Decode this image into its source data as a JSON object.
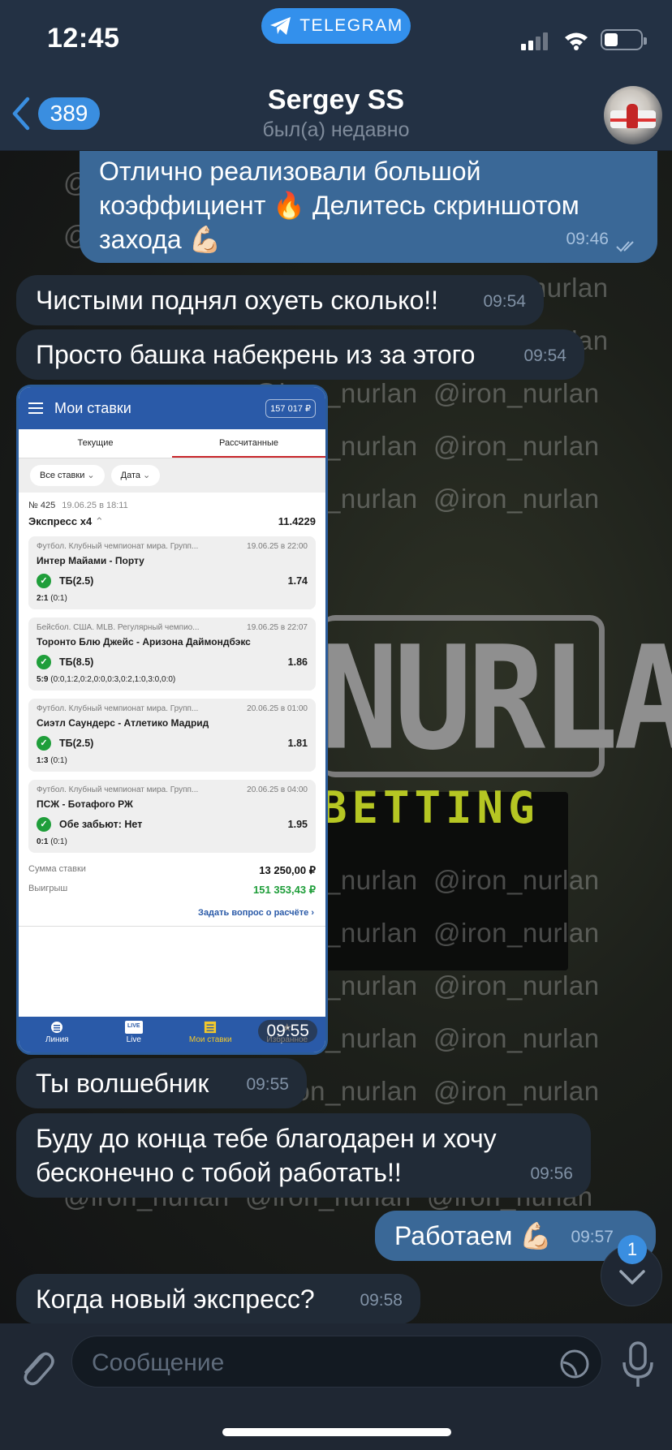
{
  "status_bar": {
    "time": "12:45",
    "app_pill": "TELEGRAM"
  },
  "header": {
    "back_count": "389",
    "name": "Sergey SS",
    "status": "был(а) недавно"
  },
  "watermark": "@iron_nurlan",
  "background_logo": {
    "big": "NURLAN",
    "small": "BETTING"
  },
  "messages": [
    {
      "dir": "out",
      "text": "Отлично реализовали большой коэффициент 🔥 Делитесь скриншотом захода 💪🏻",
      "time": "09:46"
    },
    {
      "dir": "in",
      "text": "Чистыми поднял охуеть сколько!!",
      "time": "09:54"
    },
    {
      "dir": "in",
      "text": "Просто башка набекрень из за этого",
      "time": "09:54"
    },
    {
      "dir": "in",
      "text": "Ты волшебник",
      "time": "09:55"
    },
    {
      "dir": "in",
      "text": "Буду до конца тебе благодарен и хочу бесконечно с тобой работать!!",
      "time": "09:56"
    },
    {
      "dir": "out",
      "text": "Работаем 💪🏻",
      "time": "09:57"
    },
    {
      "dir": "in",
      "text": "Когда новый экспресс?",
      "time": "09:58"
    }
  ],
  "photo": {
    "time": "09:55",
    "title": "Мои ставки",
    "balance": "157 017 ₽",
    "tabs": [
      "Текущие",
      "Рассчитанные"
    ],
    "filters": [
      "Все ставки",
      "Дата"
    ],
    "bet_number": "№ 425",
    "bet_date": "19.06.25 в 18:11",
    "express_label": "Экспресс х4",
    "express_odds": "11.4229",
    "events": [
      {
        "league": "Футбол. Клубный чемпионат мира. Групп...",
        "date": "19.06.25 в 22:00",
        "teams": "Интер Майами - Порту",
        "bet": "ТБ(2.5)",
        "odd": "1.74",
        "score": "2:1",
        "score_detail": "(0:1)"
      },
      {
        "league": "Бейсбол. США. MLB. Регулярный чемпио...",
        "date": "19.06.25 в 22:07",
        "teams": "Торонто Блю Джейс - Аризона Даймондбэкс",
        "bet": "ТБ(8.5)",
        "odd": "1.86",
        "score": "5:9",
        "score_detail": "(0:0,1:2,0:2,0:0,0:3,0:2,1:0,3:0,0:0)"
      },
      {
        "league": "Футбол. Клубный чемпионат мира. Групп...",
        "date": "20.06.25 в 01:00",
        "teams": "Сиэтл Саундерс - Атлетико Мадрид",
        "bet": "ТБ(2.5)",
        "odd": "1.81",
        "score": "1:3",
        "score_detail": "(0:1)"
      },
      {
        "league": "Футбол. Клубный чемпионат мира. Групп...",
        "date": "20.06.25 в 04:00",
        "teams": "ПСЖ - Ботафого РЖ",
        "bet": "Обе забьют: Нет",
        "odd": "1.95",
        "score": "0:1",
        "score_detail": "(0:1)"
      }
    ],
    "stake_label": "Сумма ставки",
    "stake_value": "13 250,00 ₽",
    "win_label": "Выигрыш",
    "win_value": "151 353,43 ₽",
    "ask_link": "Задать вопрос о расчёте",
    "nav": [
      "Линия",
      "Live",
      "Мои ставки",
      "Избранное"
    ],
    "live_badge": "LIVE"
  },
  "input": {
    "placeholder": "Сообщение"
  },
  "scroll_badge": "1",
  "colors": {
    "accent": "#3390ec",
    "out_bubble": "#3a6897",
    "in_bubble": "#212b37",
    "bookmaker_blue": "#2a5aa8"
  }
}
